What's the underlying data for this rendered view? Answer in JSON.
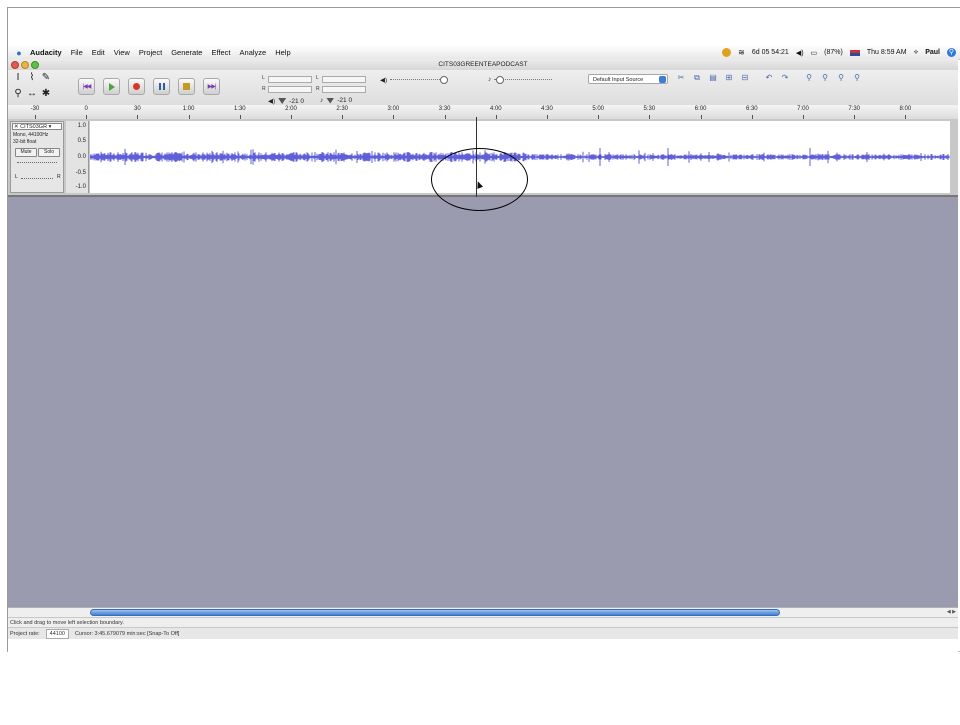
{
  "menubar": {
    "app_name": "Audacity",
    "items": [
      "File",
      "Edit",
      "View",
      "Project",
      "Generate",
      "Effect",
      "Analyze",
      "Help"
    ],
    "clock": "6d 05 54:21",
    "battery": "(87%)",
    "datetime": "Thu 8:59 AM",
    "user": "Paul"
  },
  "window": {
    "title": "CITS03GREENTEAPODCAST"
  },
  "toolbar": {
    "meter_out_value": "-21 0",
    "meter_in_value": "-21 0",
    "input_source": "Default Input Source",
    "meter_l": "L",
    "meter_r": "R"
  },
  "ruler": {
    "labels": [
      "-30",
      "0",
      "30",
      "1:00",
      "1:30",
      "2:00",
      "2:30",
      "3:00",
      "3:30",
      "4:00",
      "4:30",
      "5:00",
      "5:30",
      "6:00",
      "6:30",
      "7:00",
      "7:30",
      "8:00"
    ]
  },
  "track": {
    "name": "CITS03GR",
    "info_line1": "Mono, 44100Hz",
    "info_line2": "32-bit float",
    "mute_label": "Mute",
    "solo_label": "Solo",
    "pan_left": "L",
    "pan_right": "R",
    "scale": [
      "1.0",
      "0.5",
      "0.0",
      "-0.5",
      "-1.0"
    ],
    "waveform_color": "#3a3ad0"
  },
  "status": {
    "message": "Click and drag to move left selection boundary.",
    "project_rate_label": "Project rate:",
    "project_rate_value": "44100",
    "cursor_text": "Cursor: 3:45.679079 min:sec  [Snap-To Off]"
  },
  "colors": {
    "empty_area": "#9b9bb0",
    "scroll_thumb": "#3f7fd6",
    "record": "#d6372b",
    "play": "#4aa53c"
  }
}
